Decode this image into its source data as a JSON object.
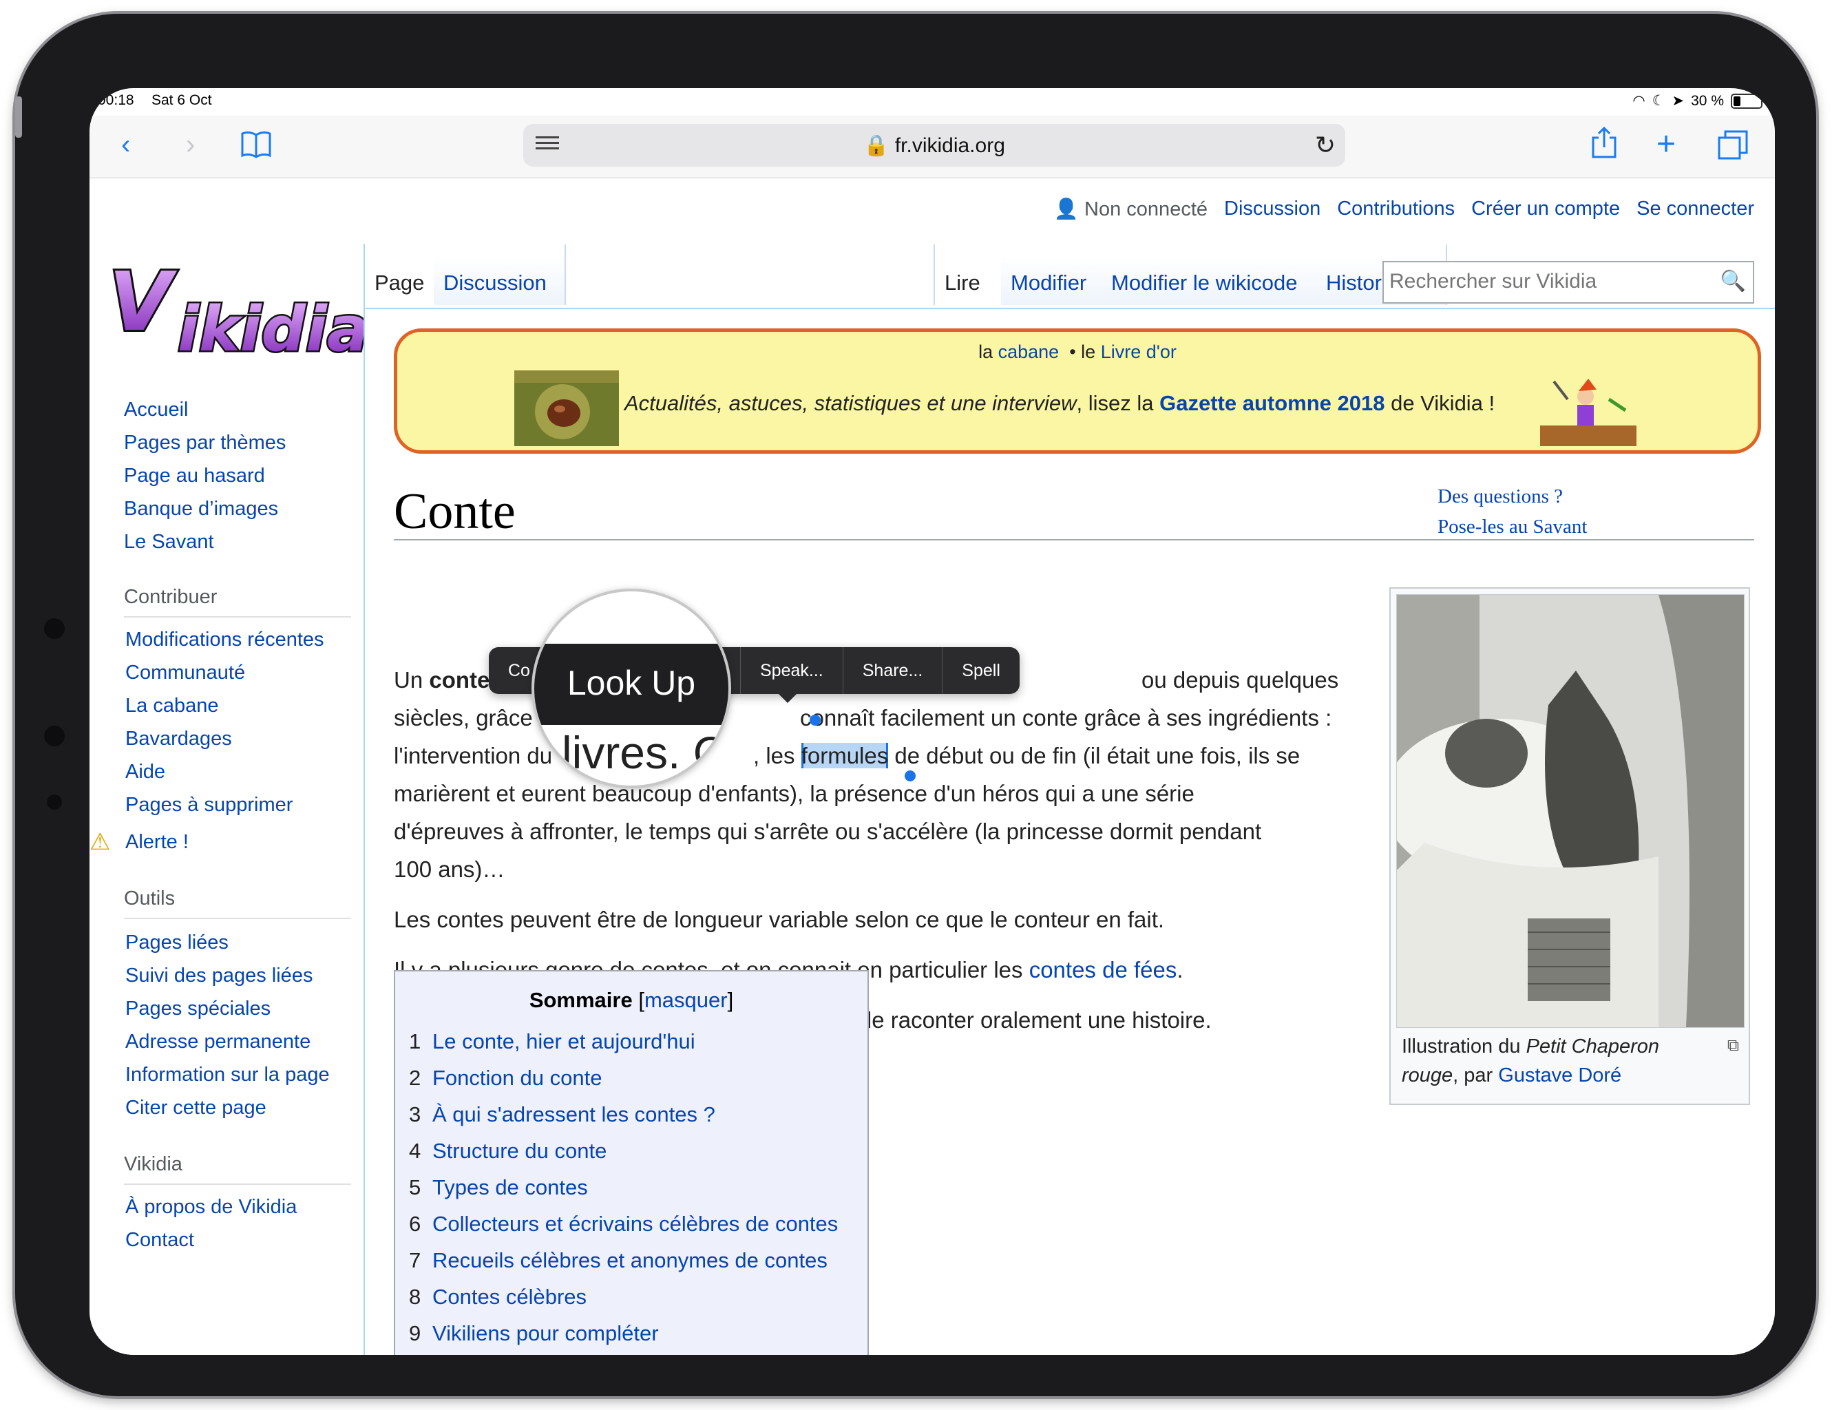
{
  "status": {
    "time": "00:18",
    "date": "Sat 6 Oct",
    "battery": "30 %"
  },
  "browser": {
    "url": "fr.vikidia.org"
  },
  "personal": {
    "user": "Non connecté",
    "links": [
      "Discussion",
      "Contributions",
      "Créer un compte",
      "Se connecter"
    ]
  },
  "logo": {
    "text": "Vikidia"
  },
  "tabs": {
    "page": "Page",
    "discussion": "Discussion",
    "read": "Lire",
    "edit": "Modifier",
    "edit_source": "Modifier le wikicode",
    "history": "Historique"
  },
  "search": {
    "placeholder": "Rechercher sur Vikidia"
  },
  "sidebar": {
    "main": [
      "Accueil",
      "Pages par thèmes",
      "Page au hasard",
      "Banque d’images",
      "Le Savant"
    ],
    "contribute_head": "Contribuer",
    "contribute": [
      "Modifications récentes",
      "Communauté",
      "La cabane",
      "Bavardages",
      "Aide",
      "Pages à supprimer",
      "Alerte !"
    ],
    "tools_head": "Outils",
    "tools": [
      "Pages liées",
      "Suivi des pages liées",
      "Pages spéciales",
      "Adresse permanente",
      "Information sur la page",
      "Citer cette page"
    ],
    "vikidia_head": "Vikidia",
    "vikidia": [
      "À propos de Vikidia",
      "Contact"
    ]
  },
  "banner": {
    "la": "la",
    "cabane": "cabane",
    "le": "• le",
    "livre": "Livre d'or",
    "text1": "Actualités, astuces, statistiques et une interview",
    "text2": ", lisez la ",
    "gazette": "Gazette automne 2018",
    "text3": " de Vikidia !"
  },
  "article": {
    "title": "Conte",
    "savant1": "Des questions ?",
    "savant2": "Pose-les au Savant",
    "p1_a": "Un",
    "p1_b": "conte",
    "p1_c": "ou depuis quelques",
    "p2_a": "siècles, grâce",
    "p2_b": "connaît facilement un conte grâce à ses ingrédients :",
    "p3_a": "l'intervention du",
    "p3_b": ", les",
    "p3_sel": "formules",
    "p3_c": "de début ou de fin (il était une fois, ils se",
    "p4": "marièrent et eurent beaucoup d'enfants), la présence d'un héros qui a une série",
    "p5": "d'épreuves à affronter, le temps qui s'arrête ou s'accélère (la princesse dormit pendant",
    "p6": "100 ans)…",
    "p7": "Les contes peuvent être de longueur variable selon ce que le conteur en fait.",
    "p8_a": "Il y a plusieurs genre de contes, et on connait en particulier les",
    "p8_link": "contes de fées",
    "p8_b": ".",
    "p9": "Le mot « conte » peut désigner aussi l'activité de raconter oralement une histoire."
  },
  "infobox": {
    "cap1": "Illustration du",
    "cap_it": "Petit Chaperon rouge",
    "cap2": ", par",
    "cap_link": "Gustave Doré"
  },
  "toc": {
    "title": "Sommaire",
    "toggle": "masquer",
    "items": [
      {
        "num": "1",
        "label": "Le conte, hier et aujourd'hui"
      },
      {
        "num": "2",
        "label": "Fonction du conte"
      },
      {
        "num": "3",
        "label": "À qui s'adressent les contes ?"
      },
      {
        "num": "4",
        "label": "Structure du conte"
      },
      {
        "num": "5",
        "label": "Types de contes"
      },
      {
        "num": "6",
        "label": "Collecteurs et écrivains célèbres de contes"
      },
      {
        "num": "7",
        "label": "Recueils célèbres et anonymes de contes"
      },
      {
        "num": "8",
        "label": "Contes célèbres"
      },
      {
        "num": "9",
        "label": "Vikiliens pour compléter"
      }
    ]
  },
  "callout": {
    "items": [
      "Co",
      "eak",
      "Speak...",
      "Share...",
      "Spell"
    ]
  },
  "loupe": {
    "label": "Look Up",
    "under": "livres. C"
  }
}
